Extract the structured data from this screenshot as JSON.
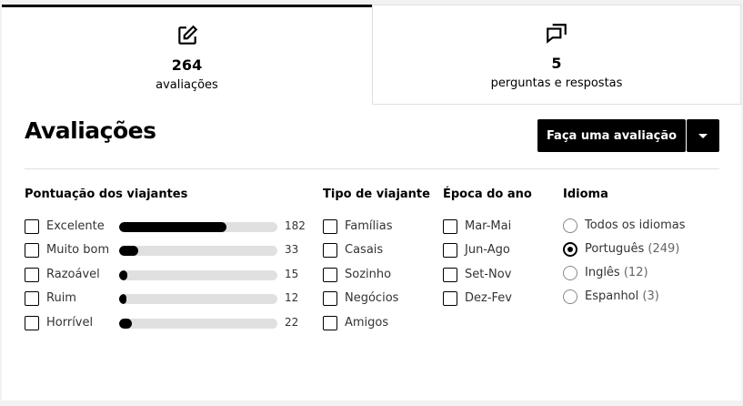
{
  "tabs": [
    {
      "count": "264",
      "label": "avaliações",
      "icon": "edit-icon"
    },
    {
      "count": "5",
      "label": "perguntas e respostas",
      "icon": "chat-bubbles-icon"
    }
  ],
  "panel": {
    "title": "Avaliações",
    "write_review_label": "Faça uma avaliação"
  },
  "ratings": {
    "heading": "Pontuação dos viajantes",
    "items": [
      {
        "label": "Excelente",
        "count": "182",
        "fraction": 0.68
      },
      {
        "label": "Muito bom",
        "count": "33",
        "fraction": 0.12
      },
      {
        "label": "Razoável",
        "count": "15",
        "fraction": 0.05
      },
      {
        "label": "Ruim",
        "count": "12",
        "fraction": 0.045
      },
      {
        "label": "Horrível",
        "count": "22",
        "fraction": 0.08
      }
    ]
  },
  "traveler_type": {
    "heading": "Tipo de viajante",
    "items": [
      "Famílias",
      "Casais",
      "Sozinho",
      "Negócios",
      "Amigos"
    ]
  },
  "season": {
    "heading": "Época do ano",
    "items": [
      "Mar-Mai",
      "Jun-Ago",
      "Set-Nov",
      "Dez-Fev"
    ]
  },
  "language": {
    "heading": "Idioma",
    "items": [
      {
        "label": "Todos os idiomas",
        "count": "",
        "selected": false
      },
      {
        "label": "Português",
        "count": "(249)",
        "selected": true
      },
      {
        "label": "Inglês",
        "count": "(12)",
        "selected": false
      },
      {
        "label": "Espanhol",
        "count": "(3)",
        "selected": false
      }
    ]
  }
}
